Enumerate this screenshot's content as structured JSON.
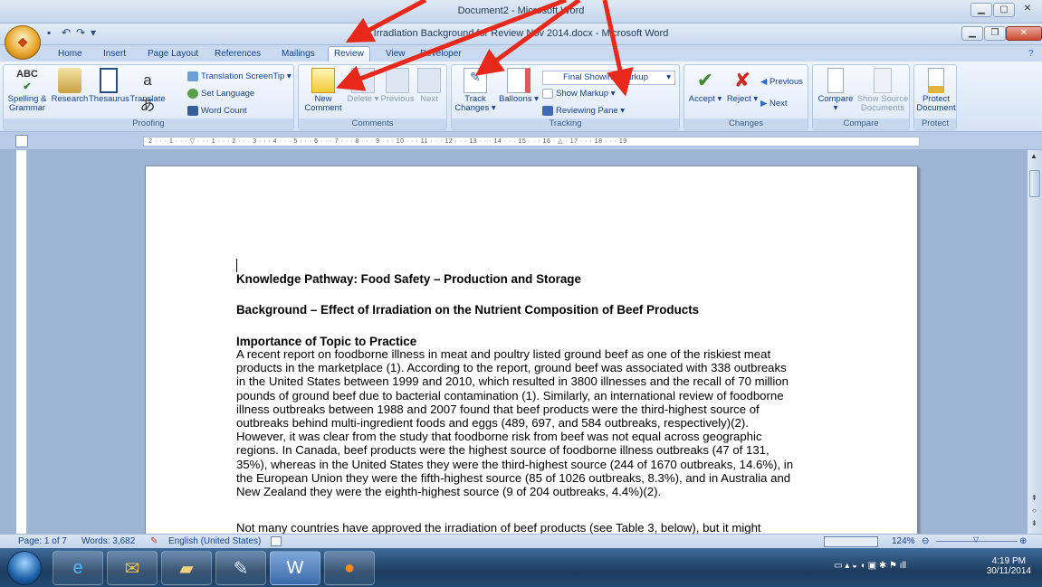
{
  "back_window": {
    "title": "Document2 - Microsoft Word"
  },
  "window": {
    "title": "Irradiation Background for Review Nov 2014.docx - Microsoft Word"
  },
  "tabs": [
    {
      "label": "Home"
    },
    {
      "label": "Insert"
    },
    {
      "label": "Page Layout"
    },
    {
      "label": "References"
    },
    {
      "label": "Mailings"
    },
    {
      "label": "Review"
    },
    {
      "label": "View"
    },
    {
      "label": "Developer"
    }
  ],
  "ribbon": {
    "proofing": {
      "label": "Proofing",
      "spelling": "Spelling & Grammar",
      "research": "Research",
      "thesaurus": "Thesaurus",
      "translate": "Translate",
      "translation_tip": "Translation ScreenTip",
      "set_language": "Set Language",
      "word_count": "Word Count"
    },
    "comments": {
      "label": "Comments",
      "new_comment": "New Comment",
      "delete": "Delete",
      "previous": "Previous",
      "next": "Next"
    },
    "tracking": {
      "label": "Tracking",
      "track_changes": "Track Changes",
      "balloons": "Balloons",
      "display_value": "Final Showing Markup",
      "show_markup": "Show Markup",
      "reviewing_pane": "Reviewing Pane"
    },
    "changes": {
      "label": "Changes",
      "accept": "Accept",
      "reject": "Reject",
      "previous": "Previous",
      "next": "Next"
    },
    "compare": {
      "label": "Compare",
      "compare": "Compare",
      "show_source": "Show Source Documents"
    },
    "protect": {
      "label": "Protect",
      "protect_document": "Protect Document"
    }
  },
  "ruler": {
    "text": "· 2 · · · 1 · · · ▽ · · · 1 · · · 2 · · · 3 · · · 4 · · · 5 · · · 6 · · · 7 · · · 8 · · · 9 · · · 10 · · · 11 · · · 12 · · · 13 · · · 14 · · · 15 · · · 16 · △ · 17 · · · 18 · · · 19"
  },
  "document": {
    "heading1": "Knowledge Pathway: Food Safety – Production and Storage",
    "heading2": "Background – Effect of Irradiation on the Nutrient Composition of Beef Products",
    "section": "Importance of Topic to Practice",
    "lines": [
      "A recent report on foodborne illness in meat and poultry listed ground beef as one of the riskiest meat",
      "products in the marketplace (1). According to the report, ground beef was associated with 338 outbreaks",
      "in the United States between 1999 and 2010, which resulted in 3800 illnesses and the recall of 70 million",
      "pounds of ground beef due to bacterial contamination (1). Similarly, an international review of foodborne",
      "illness outbreaks between 1988 and 2007 found that beef products were the third-highest source of",
      "outbreaks behind multi-ingredient foods and eggs (489, 697, and 584 outbreaks, respectively)(2).",
      "However, it was clear from the study that foodborne risk from beef was not equal across geographic",
      "regions. In Canada, beef products were the highest source of foodborne illness outbreaks (47 of 131,",
      "35%), whereas in the United States they were the third-highest source (244 of 1670 outbreaks, 14.6%), in",
      "the European Union they were the fifth-highest source (85 of 1026 outbreaks, 8.3%), and in Australia and",
      "New Zealand they were the eighth-highest source (9 of 204 outbreaks, 4.4%)(2)."
    ],
    "next_para": "Not many countries have approved the irradiation of beef products (see Table 3, below), but it might"
  },
  "status": {
    "page": "Page: 1 of 7",
    "words": "Words: 3,682",
    "language": "English (United States)",
    "zoom": "124%"
  },
  "taskbar": {
    "time": "4:19 PM",
    "date": "30/11/2014"
  },
  "colors": {
    "arrow": "#e8281a",
    "ribbon_text": "#15428b",
    "taskbar": "#1d3c5e"
  }
}
